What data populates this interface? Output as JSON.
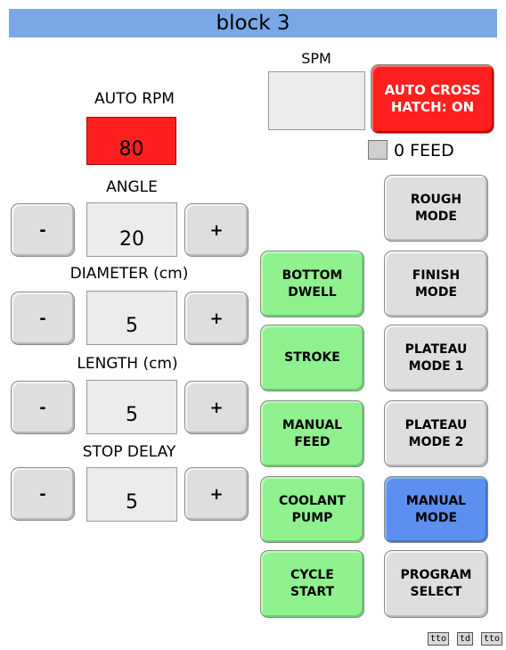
{
  "title": "block 3",
  "spm": {
    "label": "SPM",
    "value": ""
  },
  "auto_rpm": {
    "label": "AUTO RPM",
    "value": "80"
  },
  "auto_cross_hatch": {
    "label": "AUTO CROSS\nHATCH: ON"
  },
  "zero_feed": {
    "label": "0 FEED",
    "checked": false
  },
  "angle": {
    "label": "ANGLE",
    "value": "20"
  },
  "diameter": {
    "label": "DIAMETER (cm)",
    "value": "5"
  },
  "length": {
    "label": "LENGTH (cm)",
    "value": "5"
  },
  "stop_delay": {
    "label": "STOP DELAY",
    "value": "5"
  },
  "stepper": {
    "minus": "-",
    "plus": "+"
  },
  "middle_buttons": {
    "bottom_dwell": "BOTTOM\nDWELL",
    "stroke": "STROKE",
    "manual_feed": "MANUAL\nFEED",
    "coolant_pump": "COOLANT\nPUMP",
    "cycle_start": "CYCLE\nSTART"
  },
  "right_buttons": {
    "rough_mode": "ROUGH\nMODE",
    "finish_mode": "FINISH\nMODE",
    "plateau_mode_1": "PLATEAU\nMODE 1",
    "plateau_mode_2": "PLATEAU\nMODE 2",
    "manual_mode": "MANUAL\nMODE",
    "program_select": "PROGRAM\nSELECT"
  },
  "footer": {
    "b1": "tto",
    "b2": "td",
    "b3": "tto"
  },
  "colors": {
    "title_bg": "#7aa8e6",
    "active_green": "#8ff28f",
    "selected_blue": "#5c8ff0",
    "alert_red": "#ff1f1f"
  }
}
